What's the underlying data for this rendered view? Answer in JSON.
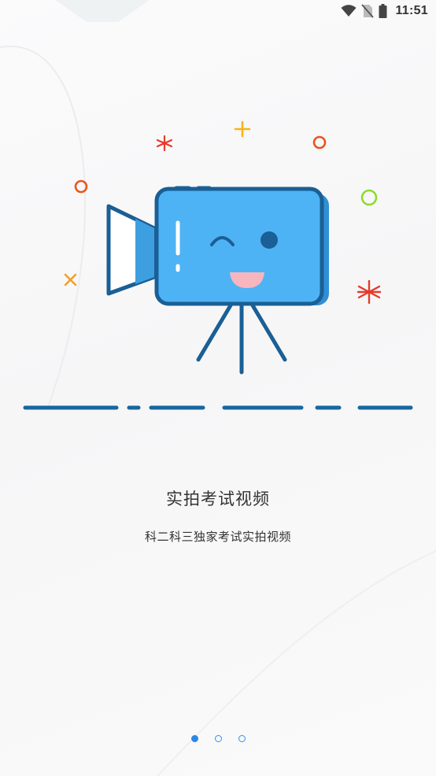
{
  "status_bar": {
    "time": "11:51",
    "icons": [
      "wifi-icon",
      "no-sim-icon",
      "battery-icon"
    ]
  },
  "onboarding": {
    "title": "实拍考试视频",
    "subtitle": "科二科三独家考试实拍视频",
    "illustration": "video-camera-icon"
  },
  "pager": {
    "pages": 3,
    "active_index": 0
  },
  "colors": {
    "camera_body": "#4eb3f5",
    "camera_outline": "#1a5f95",
    "dash_line": "#17679e",
    "active_dot": "#2f86e2",
    "text": "#333333"
  }
}
